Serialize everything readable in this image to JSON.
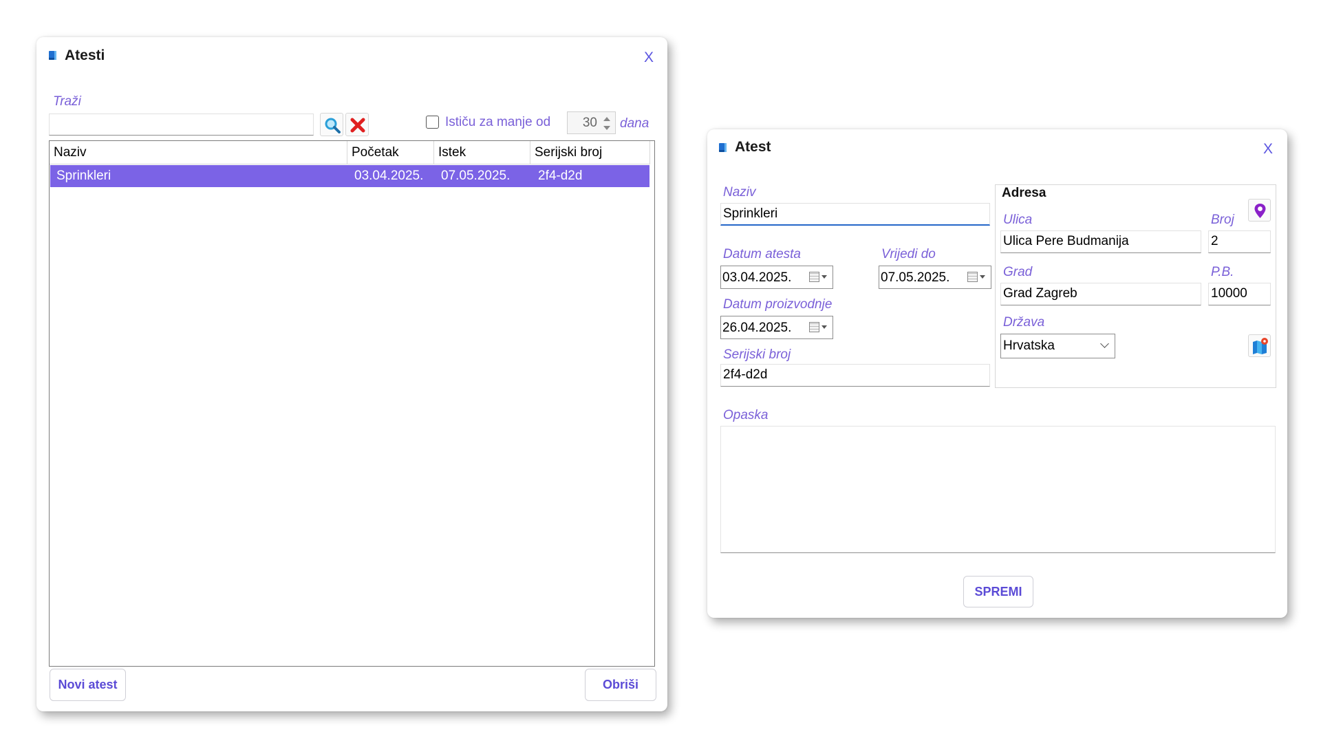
{
  "atesti_window": {
    "title": "Atesti",
    "close_label": "X",
    "search": {
      "label": "Traži",
      "value": ""
    },
    "expiring_filter": {
      "label": "Ističu za manje od",
      "checked": false,
      "days": "30",
      "unit": "dana"
    },
    "table": {
      "columns": [
        "Naziv",
        "Početak",
        "Istek",
        "Serijski broj"
      ],
      "rows": [
        {
          "naziv": "Sprinkleri",
          "pocetak": "03.04.2025.",
          "istek": "07.05.2025.",
          "serijski": "2f4-d2d",
          "selected": true
        }
      ]
    },
    "new_button": "Novi atest",
    "delete_button": "Obriši"
  },
  "atest_window": {
    "title": "Atest",
    "close_label": "X",
    "naziv": {
      "label": "Naziv",
      "value": "Sprinkleri"
    },
    "datum_atesta": {
      "label": "Datum atesta",
      "value": "03.04.2025."
    },
    "vrijedi_do": {
      "label": "Vrijedi do",
      "value": "07.05.2025."
    },
    "datum_proizvodnje": {
      "label": "Datum proizvodnje",
      "value": "26.04.2025."
    },
    "serijski_broj": {
      "label": "Serijski broj",
      "value": "2f4-d2d"
    },
    "adresa": {
      "heading": "Adresa",
      "ulica": {
        "label": "Ulica",
        "value": "Ulica Pere Budmanija"
      },
      "broj": {
        "label": "Broj",
        "value": "2"
      },
      "grad": {
        "label": "Grad",
        "value": "Grad Zagreb"
      },
      "pb": {
        "label": "P.B.",
        "value": "10000"
      },
      "drzava": {
        "label": "Država",
        "value": "Hrvatska"
      }
    },
    "opaska": {
      "label": "Opaska",
      "value": ""
    },
    "save_button": "SPREMI"
  },
  "colors": {
    "accent": "#7b63e6",
    "label": "#7a60d8",
    "button_text": "#5b4bd6",
    "close": "#5b55e0",
    "delete_icon": "#e02020",
    "pin_icon": "#8a20c8"
  },
  "icons": {
    "window": "document-icon",
    "search": "magnifier-icon",
    "clear": "red-x-icon",
    "calendar": "calendar-dropdown-icon",
    "location": "map-pin-icon",
    "map": "map-icon"
  }
}
